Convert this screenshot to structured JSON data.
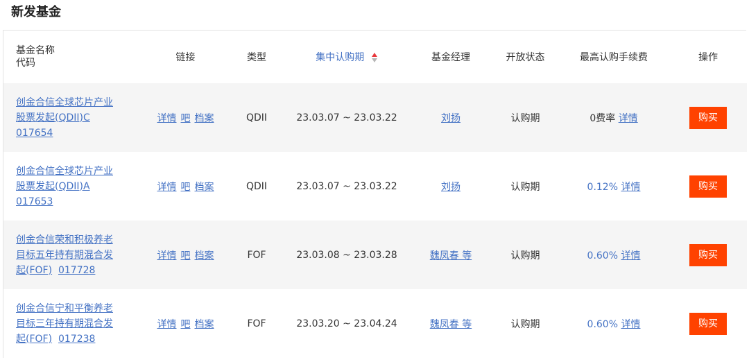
{
  "page_title": "新发基金",
  "columns": {
    "name_line1": "基金名称",
    "name_line2": "代码",
    "links": "链接",
    "type": "类型",
    "period": "集中认购期",
    "manager": "基金经理",
    "status": "开放状态",
    "fee": "最高认购手续费",
    "action": "操作"
  },
  "sort": {
    "column": "集中认购期",
    "active_direction": "asc",
    "icon": "sort-up-down-icon"
  },
  "colors": {
    "link": "#4472c4",
    "buy_button": "#ff4200",
    "sort_active": "#e8383d",
    "row_alt": "#f5f5f5"
  },
  "rows": [
    {
      "name_lines": [
        "创金合信全球芯片产业",
        "股票发起(QDII)C",
        "017654"
      ],
      "links": [
        "详情",
        "吧",
        "档案"
      ],
      "type": "QDII",
      "period": "23.03.07 ~ 23.03.22",
      "manager": "刘扬",
      "status": "认购期",
      "fee_value": "0费率",
      "fee_link": "详情",
      "buy": "购买"
    },
    {
      "name_lines": [
        "创金合信全球芯片产业",
        "股票发起(QDII)A",
        "017653"
      ],
      "links": [
        "详情",
        "吧",
        "档案"
      ],
      "type": "QDII",
      "period": "23.03.07 ~ 23.03.22",
      "manager": "刘扬",
      "status": "认购期",
      "fee_value": "0.12%",
      "fee_link": "详情",
      "buy": "购买"
    },
    {
      "name_lines": [
        "创金合信荣和积极养老",
        "目标五年持有期混合发",
        "起(FOF)"
      ],
      "code": "017728",
      "links": [
        "详情",
        "吧",
        "档案"
      ],
      "type": "FOF",
      "period": "23.03.08 ~ 23.03.28",
      "manager": "魏凤春 等",
      "status": "认购期",
      "fee_value": "0.60%",
      "fee_link": "详情",
      "buy": "购买"
    },
    {
      "name_lines": [
        "创金合信宁和平衡养老",
        "目标三年持有期混合发",
        "起(FOF)"
      ],
      "code": "017238",
      "links": [
        "详情",
        "吧",
        "档案"
      ],
      "type": "FOF",
      "period": "23.03.20 ~ 23.04.24",
      "manager": "魏凤春 等",
      "status": "认购期",
      "fee_value": "0.60%",
      "fee_link": "详情",
      "buy": "购买"
    }
  ]
}
